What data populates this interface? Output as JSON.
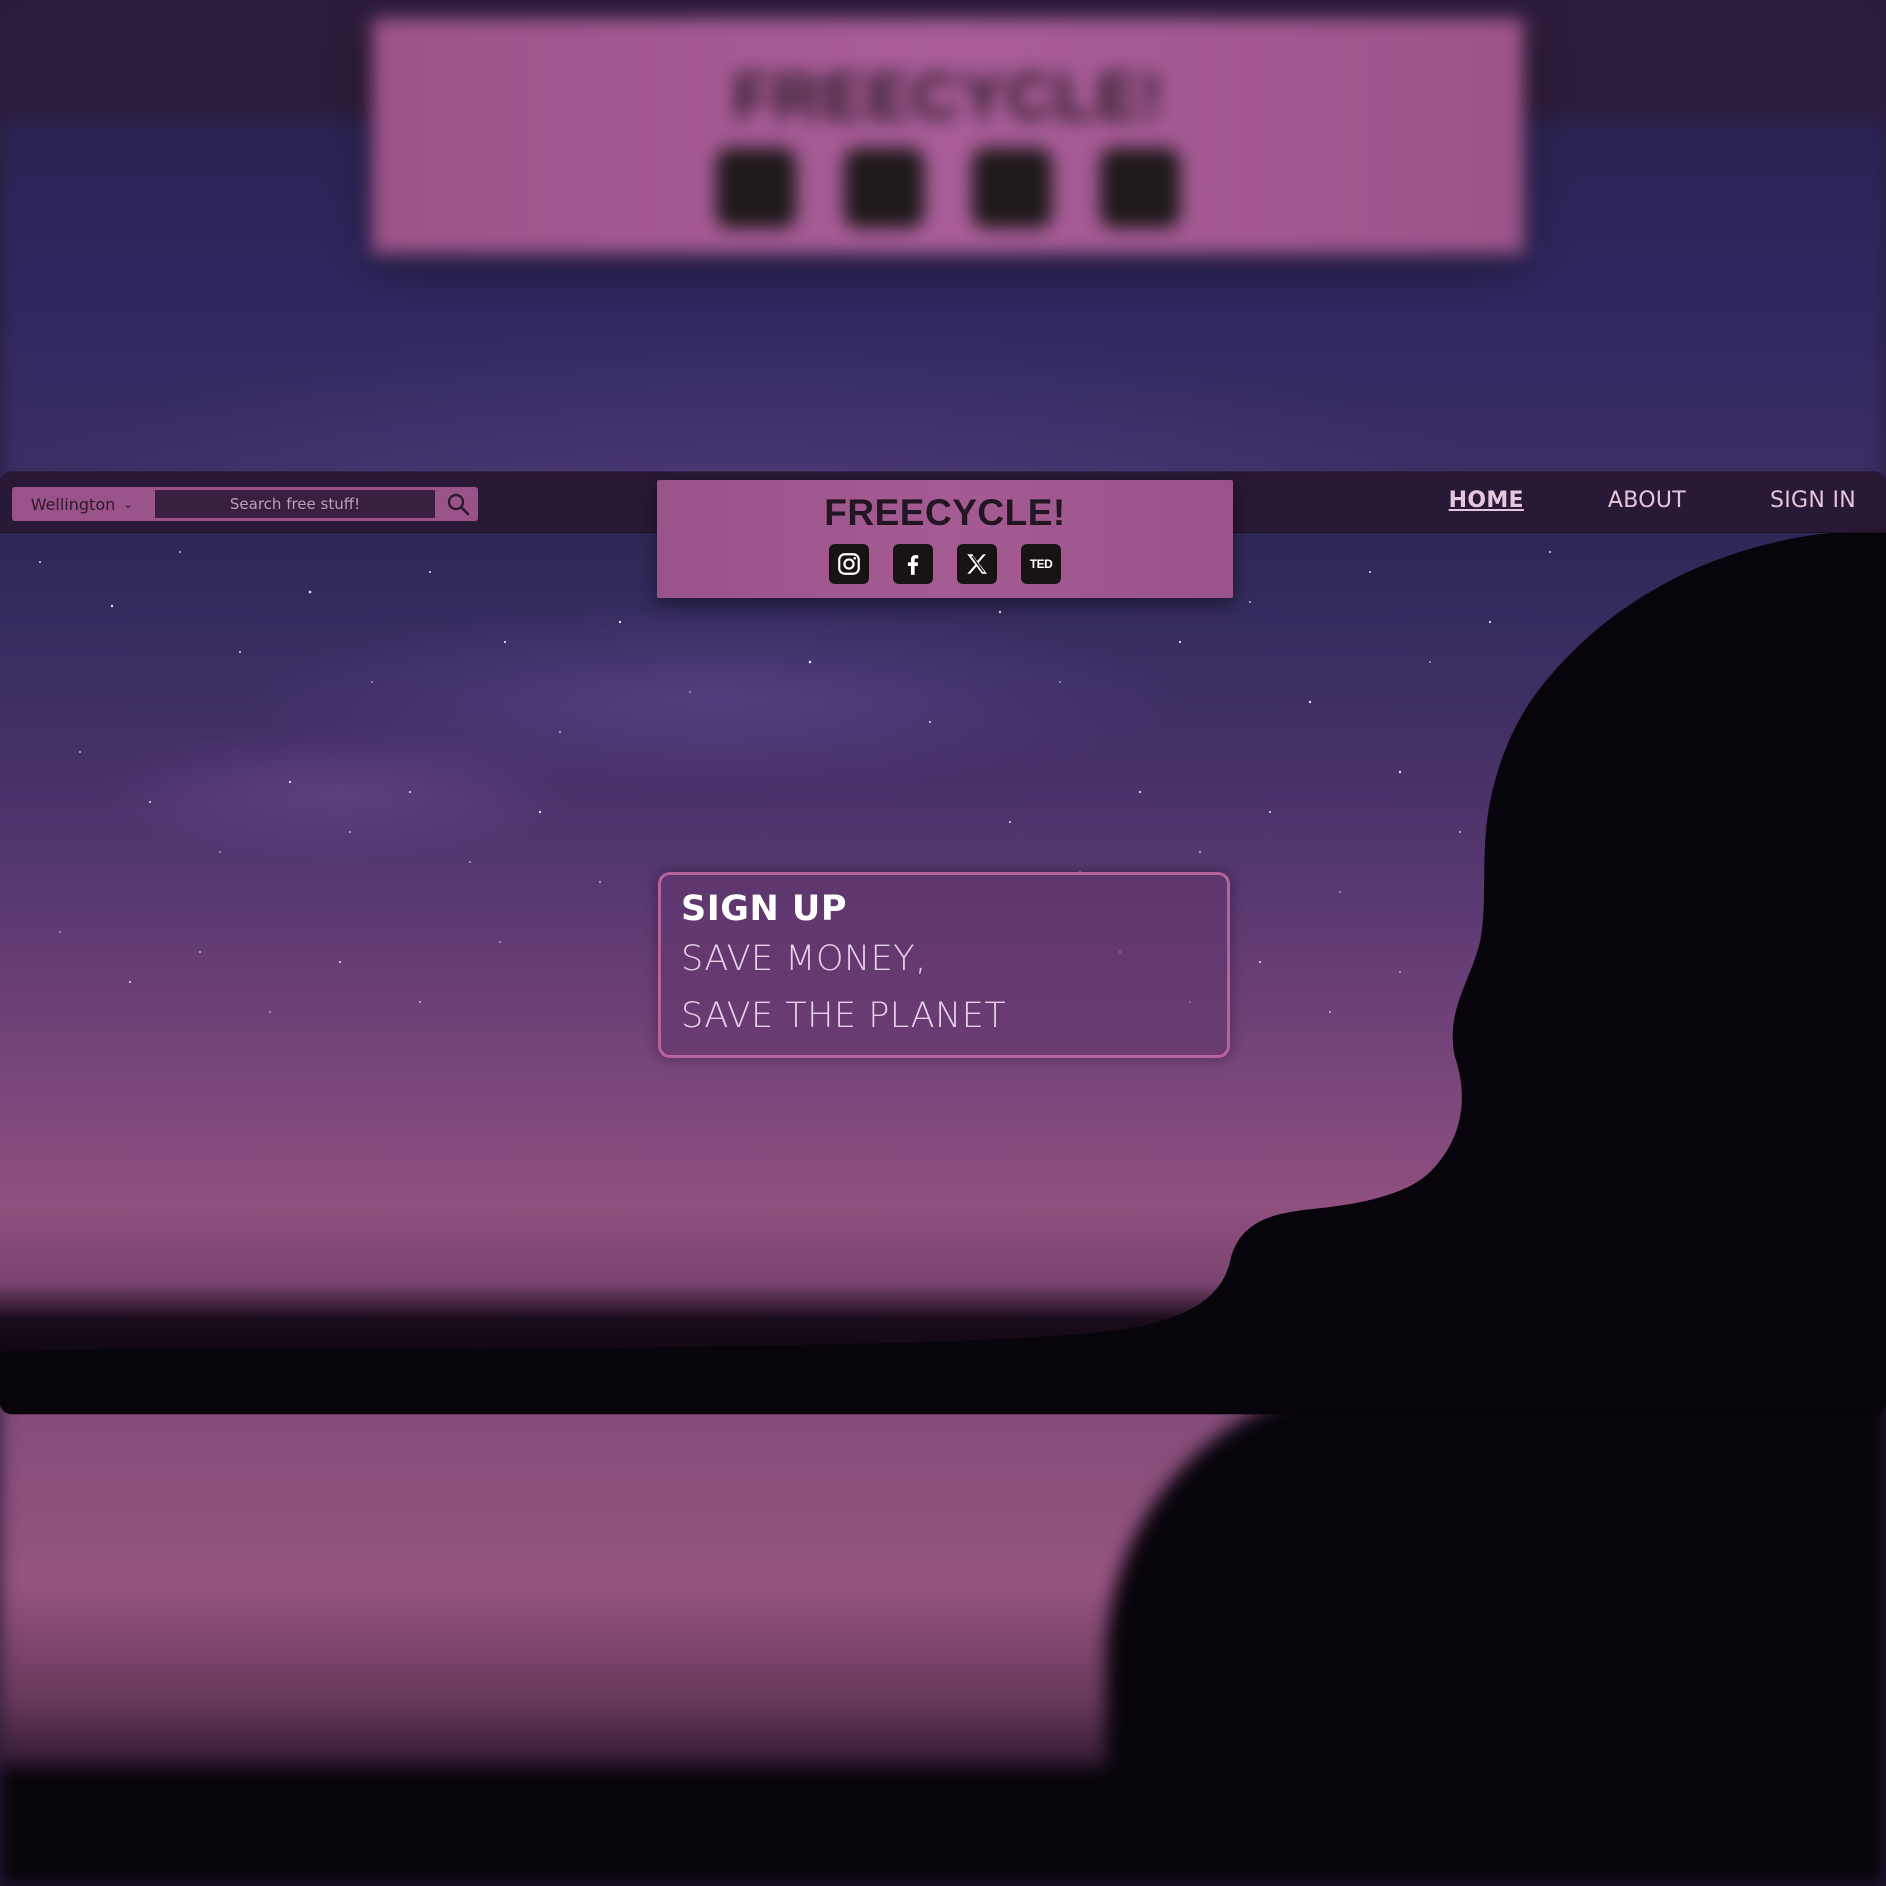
{
  "brand": {
    "title": "FREECYCLE!",
    "accent_color": "#9a5389",
    "nav_bg": "#281834"
  },
  "search": {
    "location_selected": "Wellington",
    "placeholder": "Search free stuff!",
    "button_icon": "search-icon"
  },
  "social_links": [
    {
      "name": "instagram",
      "icon": "instagram-icon"
    },
    {
      "name": "facebook",
      "icon": "facebook-icon"
    },
    {
      "name": "x",
      "icon": "x-icon"
    },
    {
      "name": "ted",
      "icon": "ted-icon",
      "label": "TED"
    }
  ],
  "nav": {
    "items": [
      {
        "label": "HOME",
        "active": true
      },
      {
        "label": "ABOUT",
        "active": false
      },
      {
        "label": "SIGN IN",
        "active": false
      }
    ]
  },
  "hero": {
    "headline": "SIGN UP",
    "line1": "SAVE MONEY,",
    "line2": "SAVE THE PLANET"
  }
}
